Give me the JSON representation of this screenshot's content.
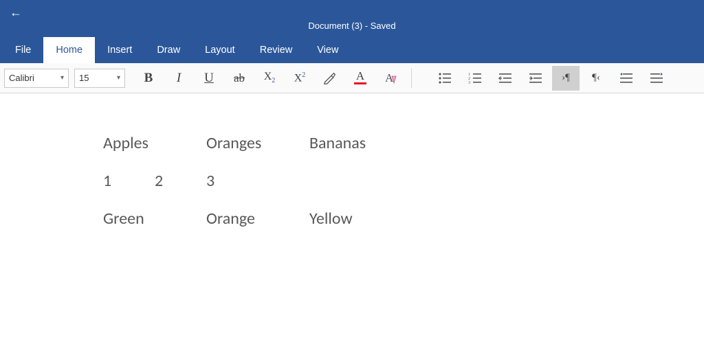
{
  "title": "Document (3) - Saved",
  "menu": {
    "file": "File",
    "home": "Home",
    "insert": "Insert",
    "draw": "Draw",
    "layout": "Layout",
    "review": "Review",
    "view": "View",
    "active": "home"
  },
  "ribbon": {
    "font_name": "Calibri",
    "font_size": "15"
  },
  "document": {
    "rows": [
      [
        "Apples",
        "",
        "Oranges",
        "Bananas"
      ],
      [
        "1",
        "2",
        "3",
        ""
      ],
      [
        "Green",
        "",
        "Orange",
        "Yellow"
      ]
    ]
  }
}
